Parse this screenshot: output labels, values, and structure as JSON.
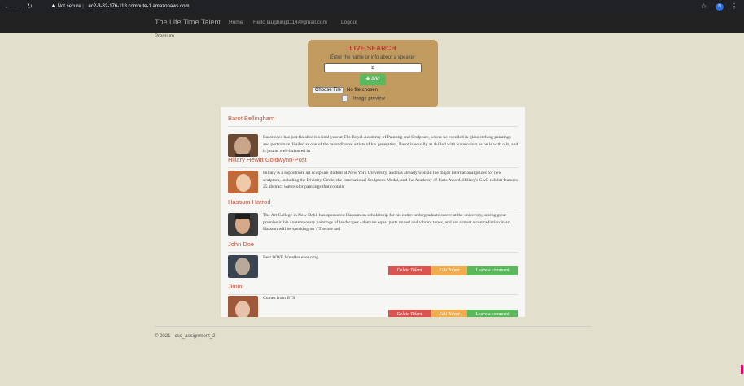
{
  "browser": {
    "nav_icons": [
      "back-arrow-icon",
      "forward-arrow-icon",
      "reload-icon"
    ],
    "security_label": "Not secure",
    "url": "ec2-3-82-176-118.compute-1.amazonaws.com",
    "profile_initial": "N"
  },
  "site_nav": {
    "brand": "The Life Time Talent",
    "home": "Home",
    "hello": "Hello laughing1114@gmail.com",
    "logout": "Logout"
  },
  "premium": "Premium",
  "search": {
    "title": "LIVE SEARCH",
    "hint": "Enter the name or info about a speaker",
    "value": "b",
    "add_label": "Add",
    "choose_file": "Choose File",
    "no_file": "No file chosen",
    "preview_alt": "Image preview"
  },
  "talents": [
    {
      "name": "Barot Bellingham",
      "description": "Barot edee has just finished his final year at The Royal Academy of Painting and Sculpture, where he excelled in glass etching paintings and portraiture. Hailed as one of the most diverse artists of his generation, Barot is equally as skilled with watercolors as he is with oils, and is just as well-balanced in",
      "avatar_colors": [
        "#6b4a33",
        "#c9a58a"
      ]
    },
    {
      "name": "Hillary Hewitt Goldwynn-Post",
      "description": "Hillary is a sophomore art sculpture student at New York University, and has already won all the major international prizes for new sculptors, including the Divinity Circle, the International Sculptor's Medal, and the Academy of Paris Award. Hillary's CAC exhibit features 25 abstract watercolor paintings that contain",
      "avatar_colors": [
        "#c06a3a",
        "#f0c9a8"
      ]
    },
    {
      "name": "Hassum Harrod",
      "description": "The Art College in New Dehli has sponsored Hassum on scholarship for his entire undergraduate career at the university, seeing great promise in his contemporary paintings of landscapes - that use equal parts muted and vibrant tones, and are almost a contradiction in art. Hassum will be speaking on \\\"The use and",
      "avatar_colors": [
        "#2b2b2b",
        "#d6a98a"
      ]
    },
    {
      "name": "John Doe",
      "description": "Best WWE Wrestler ever omg",
      "avatar_colors": [
        "#3a4450",
        "#b9a99a"
      ]
    },
    {
      "name": "Jimin",
      "description": "Comes from BTS",
      "avatar_colors": [
        "#a0583a",
        "#e8c2a8"
      ]
    }
  ],
  "actions": {
    "delete": "Delete Talent",
    "edit": "Edit Talent",
    "comment": "Leave a comment"
  },
  "footer": "© 2021 - csc_assignment_2",
  "colors": {
    "background": "#e2dfcc",
    "nav": "#222222",
    "search_panel": "#c19a5f",
    "title_red": "#c0392b",
    "name_color": "#c0533a",
    "danger": "#d9534f",
    "warning": "#f0ad4e",
    "success": "#5cb85c"
  }
}
